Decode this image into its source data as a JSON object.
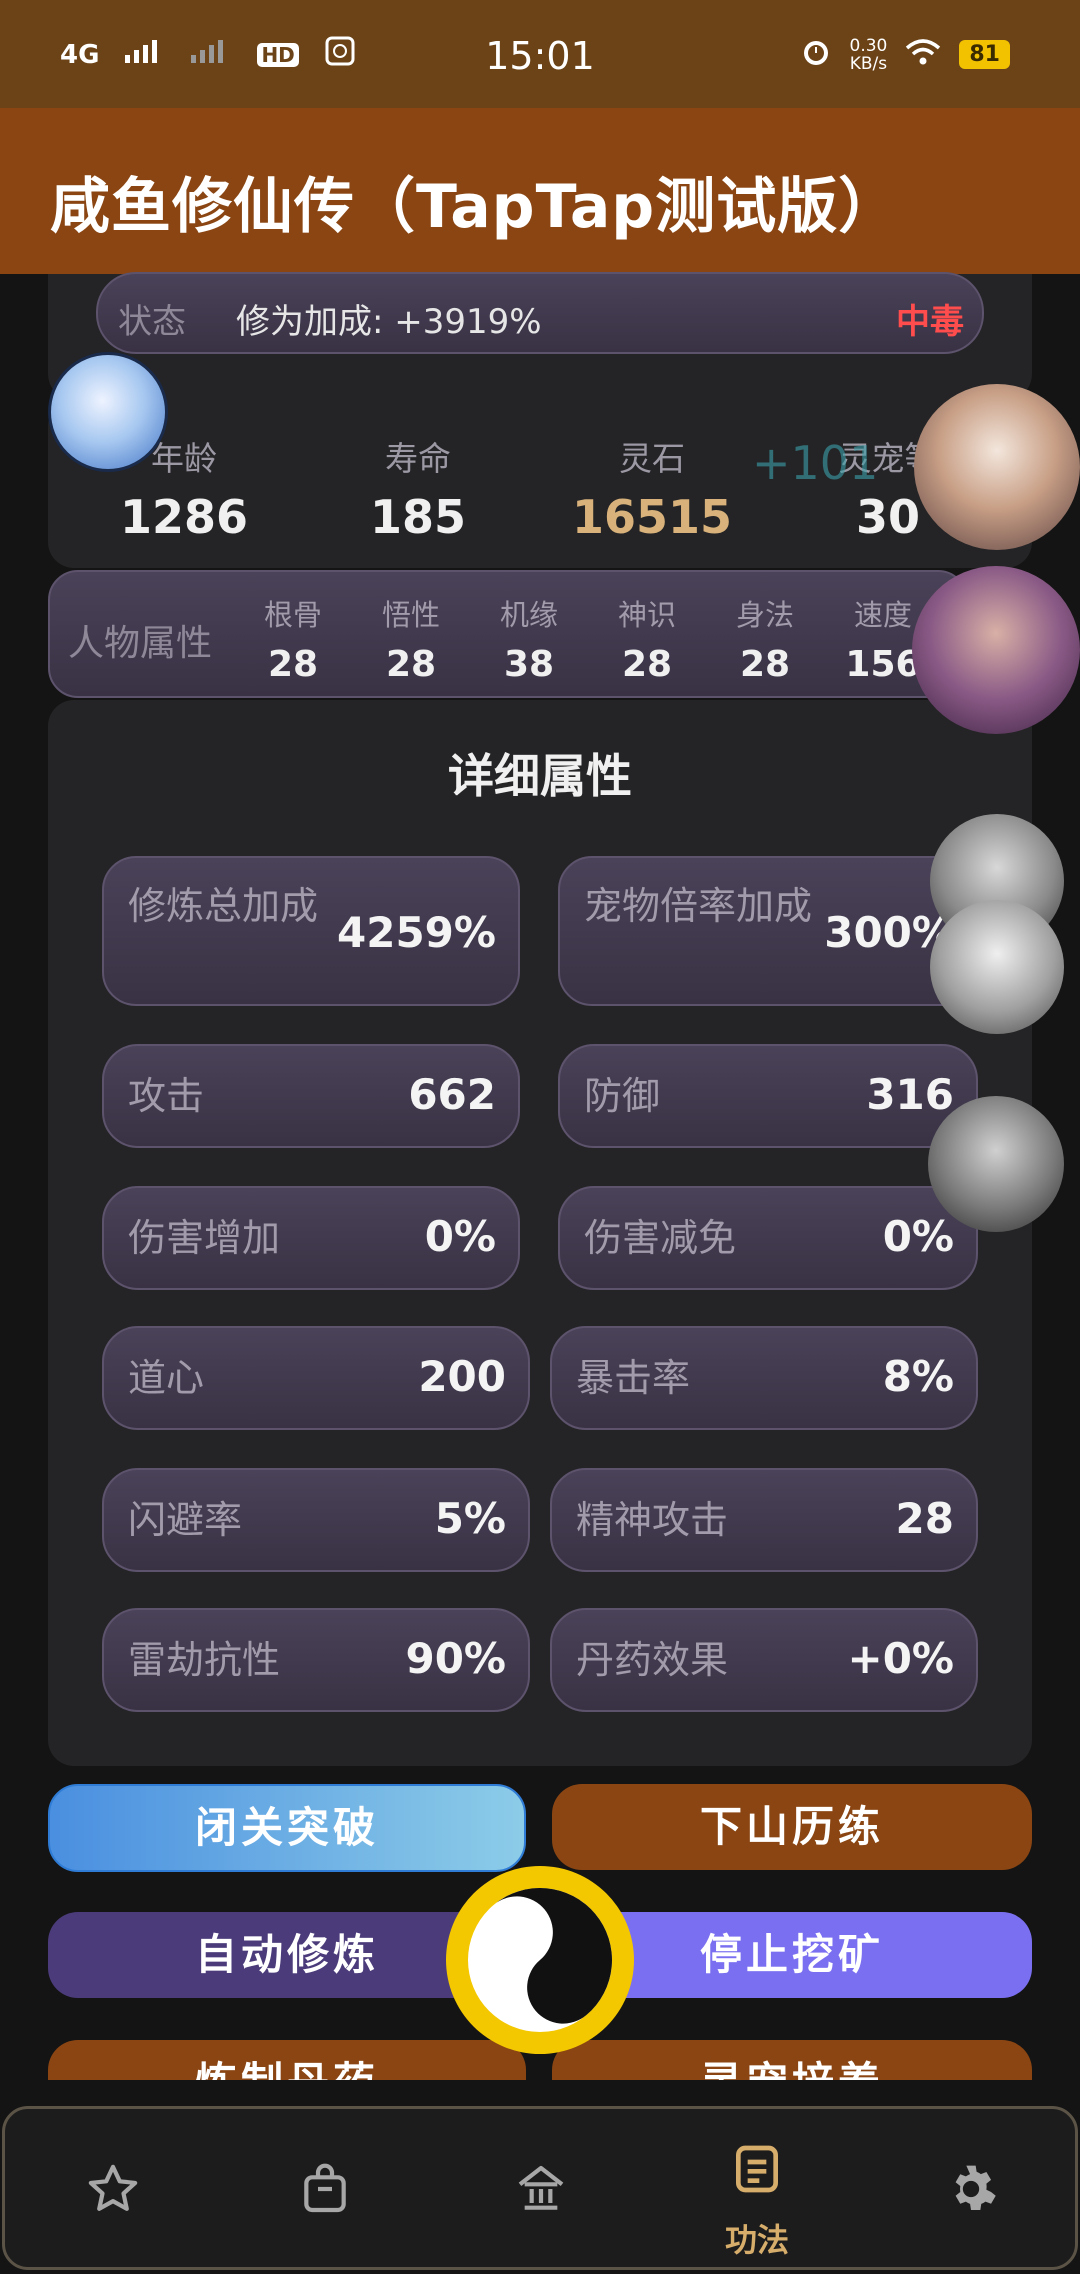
{
  "status_bar": {
    "network": "4G",
    "hd": "HD",
    "time": "15:01",
    "speed_value": "0.30",
    "speed_unit": "KB/s",
    "battery": "81"
  },
  "app_title": "咸鱼修仙传（TapTap测试版）",
  "status_row": {
    "label": "状态",
    "value": "修为加成: +3919%",
    "tag": "中毒"
  },
  "stats": [
    {
      "label": "年龄",
      "value": "1286"
    },
    {
      "label": "寿命",
      "value": "185"
    },
    {
      "label": "灵石",
      "value": "16515"
    },
    {
      "label": "灵宠等",
      "value": "30"
    }
  ],
  "stats_overlay": "+101",
  "attributes": {
    "title": "人物属性",
    "items": [
      {
        "label": "根骨",
        "value": "28"
      },
      {
        "label": "悟性",
        "value": "28"
      },
      {
        "label": "机缘",
        "value": "38"
      },
      {
        "label": "神识",
        "value": "28"
      },
      {
        "label": "身法",
        "value": "28"
      },
      {
        "label": "速度",
        "value": "156"
      }
    ]
  },
  "detail": {
    "title": "详细属性",
    "cells": [
      {
        "label": "修炼总加成",
        "value": "4259%"
      },
      {
        "label": "宠物倍率加成",
        "value": "300%"
      },
      {
        "label": "攻击",
        "value": "662"
      },
      {
        "label": "防御",
        "value": "316"
      },
      {
        "label": "伤害增加",
        "value": "0%"
      },
      {
        "label": "伤害减免",
        "value": "0%"
      },
      {
        "label": "道心",
        "value": "200"
      },
      {
        "label": "暴击率",
        "value": "8%"
      },
      {
        "label": "闪避率",
        "value": "5%"
      },
      {
        "label": "精神攻击",
        "value": "28"
      },
      {
        "label": "雷劫抗性",
        "value": "90%"
      },
      {
        "label": "丹药效果",
        "value": "+0%"
      }
    ]
  },
  "buttons": {
    "breakthrough": "闭关突破",
    "descend": "下山历练",
    "auto_cultivate": "自动修炼",
    "stop_mining": "停止挖矿",
    "alchemy": "炼制丹药",
    "pet_care": "灵宠培养"
  },
  "nav": {
    "active_label": "功法",
    "icons": [
      "star-icon",
      "bag-icon",
      "home-icon",
      "scroll-icon",
      "gear-icon"
    ]
  },
  "colors": {
    "appbar": "#8a4512",
    "statusbar": "#6b4317",
    "poison": "#ff4c4c",
    "spirit_stone": "#d8b27a",
    "nav_active": "#d6ad6a"
  }
}
